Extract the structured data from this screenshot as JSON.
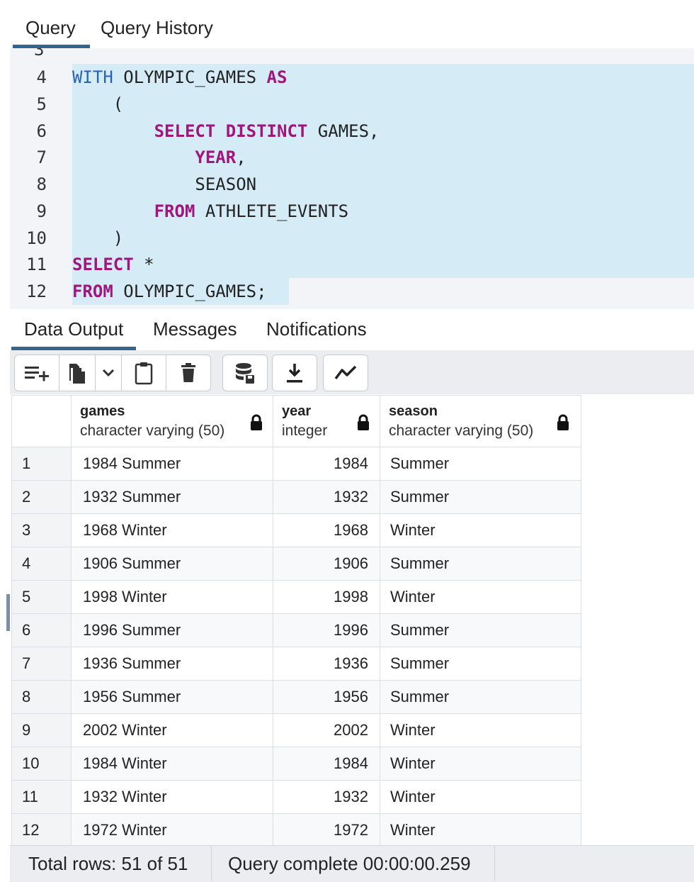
{
  "tabs": {
    "query": "Query",
    "history": "Query History"
  },
  "editor": {
    "partial_line_number": "3",
    "lines": [
      {
        "n": "4",
        "code": "WITH OLYMPIC_GAMES AS"
      },
      {
        "n": "5",
        "code": "    ("
      },
      {
        "n": "6",
        "code": "        SELECT DISTINCT GAMES,"
      },
      {
        "n": "7",
        "code": "            YEAR,"
      },
      {
        "n": "8",
        "code": "            SEASON"
      },
      {
        "n": "9",
        "code": "        FROM ATHLETE_EVENTS"
      },
      {
        "n": "10",
        "code": "    )"
      },
      {
        "n": "11",
        "code": "SELECT *"
      },
      {
        "n": "12",
        "code": "FROM OLYMPIC_GAMES;"
      }
    ]
  },
  "result_tabs": {
    "data_output": "Data Output",
    "messages": "Messages",
    "notifications": "Notifications"
  },
  "toolbar": {
    "icons": [
      "add-row-icon",
      "copy-icon",
      "chevron-down-icon",
      "paste-icon",
      "delete-icon",
      "save-data-icon",
      "download-icon",
      "graph-icon"
    ]
  },
  "grid": {
    "columns": [
      {
        "name": "games",
        "type": "character varying (50)"
      },
      {
        "name": "year",
        "type": "integer"
      },
      {
        "name": "season",
        "type": "character varying (50)"
      }
    ],
    "rows": [
      [
        "1",
        "1984 Summer",
        "1984",
        "Summer"
      ],
      [
        "2",
        "1932 Summer",
        "1932",
        "Summer"
      ],
      [
        "3",
        "1968 Winter",
        "1968",
        "Winter"
      ],
      [
        "4",
        "1906 Summer",
        "1906",
        "Summer"
      ],
      [
        "5",
        "1998 Winter",
        "1998",
        "Winter"
      ],
      [
        "6",
        "1996 Summer",
        "1996",
        "Summer"
      ],
      [
        "7",
        "1936 Summer",
        "1936",
        "Summer"
      ],
      [
        "8",
        "1956 Summer",
        "1956",
        "Summer"
      ],
      [
        "9",
        "2002 Winter",
        "2002",
        "Winter"
      ],
      [
        "10",
        "1984 Winter",
        "1984",
        "Winter"
      ],
      [
        "11",
        "1932 Winter",
        "1932",
        "Winter"
      ],
      [
        "12",
        "1972 Winter",
        "1972",
        "Winter"
      ]
    ]
  },
  "status": {
    "total_rows": "Total rows: 51 of 51",
    "query_complete": "Query complete 00:00:00.259"
  },
  "colors": {
    "accent": "#326690",
    "keyword": "#a0167d",
    "with_keyword": "#2a63b4",
    "selection": "#d5ecf7"
  }
}
